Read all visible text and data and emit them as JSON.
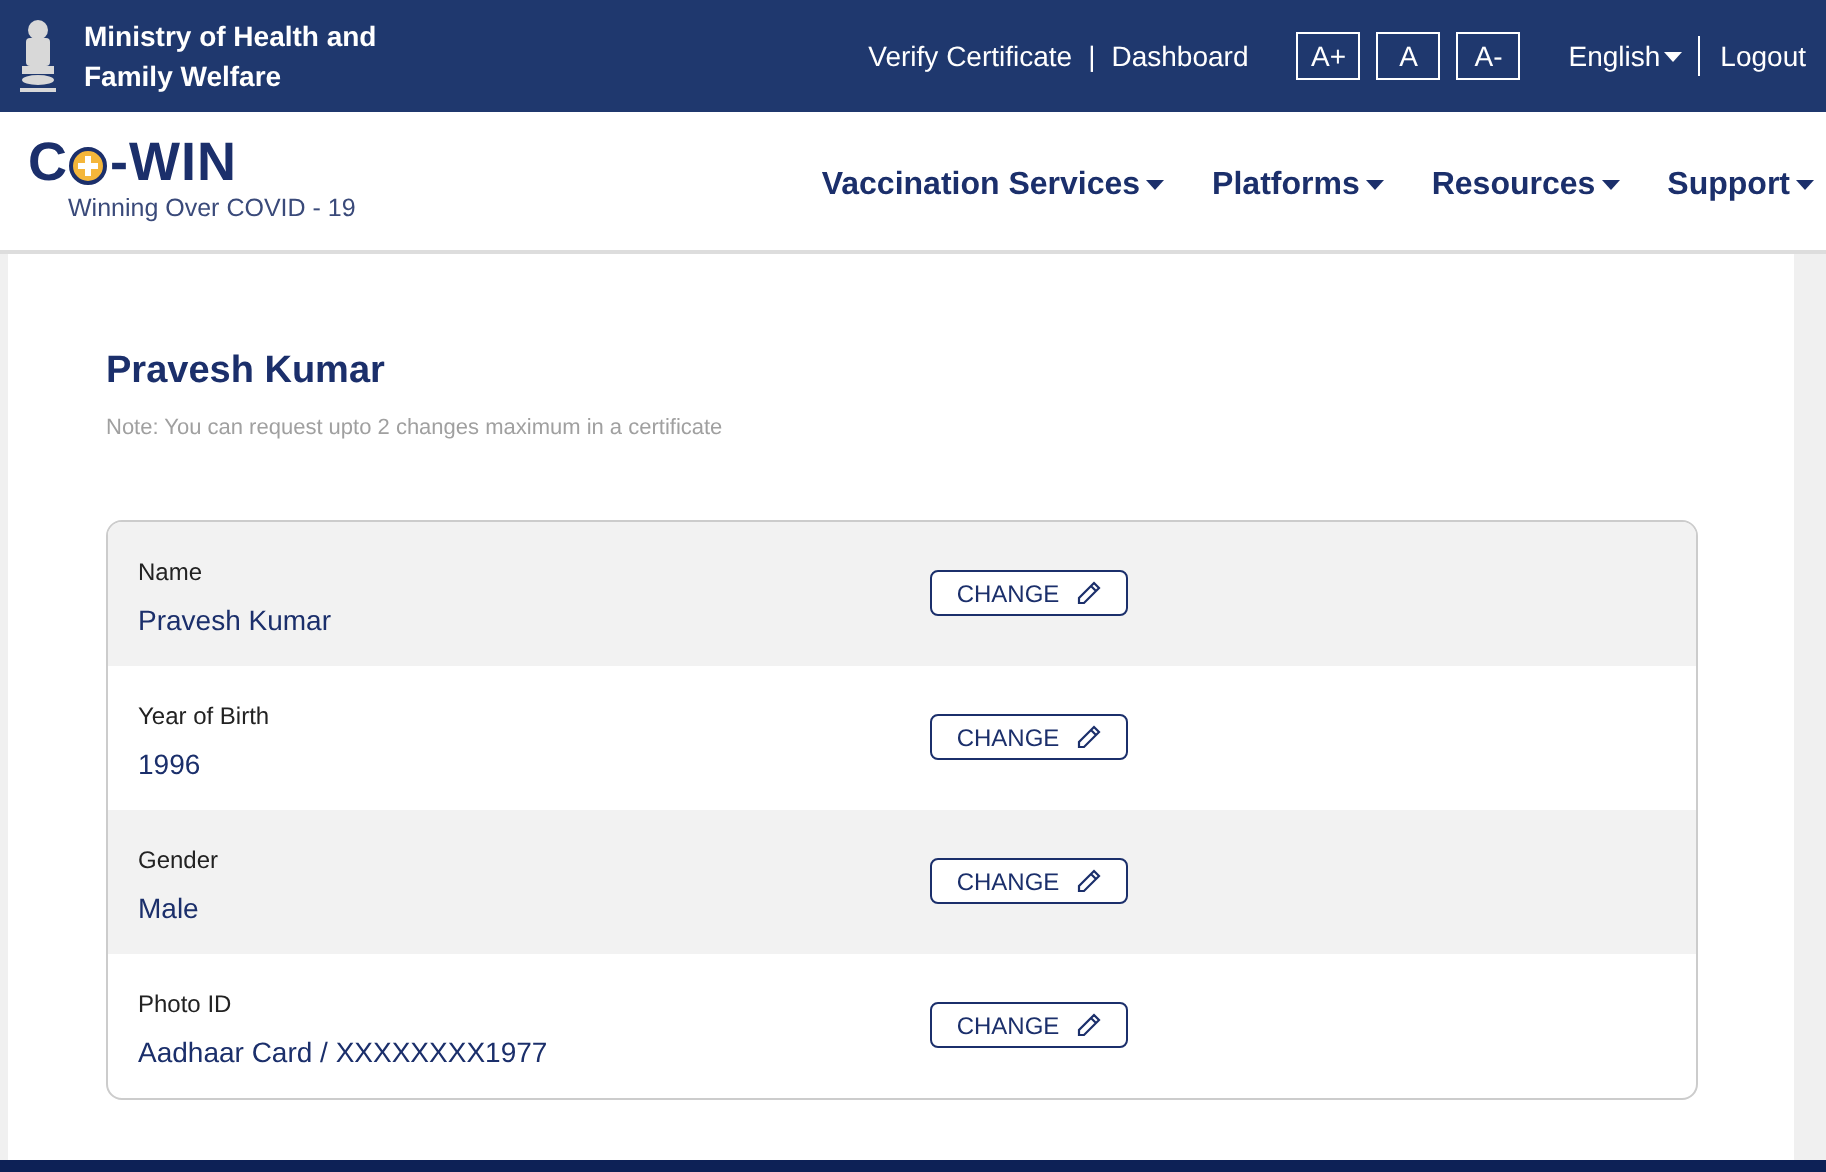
{
  "header": {
    "ministry": [
      "Ministry of Health and",
      "Family Welfare"
    ],
    "links": [
      "Verify Certificate",
      "Dashboard"
    ],
    "separator": "|",
    "font_buttons": [
      "A+",
      "A",
      "A-"
    ],
    "language": "English",
    "logout": "Logout"
  },
  "navbar": {
    "logo": {
      "left": "C",
      "right": "-WIN",
      "tagline": "Winning Over COVID - 19"
    },
    "menus": [
      "Vaccination Services",
      "Platforms",
      "Resources",
      "Support"
    ]
  },
  "profile": {
    "title": "Pravesh Kumar",
    "note": "Note: You can request upto 2 changes maximum in a certificate",
    "fields": [
      {
        "label": "Name",
        "value": "Pravesh Kumar",
        "button": "CHANGE"
      },
      {
        "label": "Year of Birth",
        "value": "1996",
        "button": "CHANGE"
      },
      {
        "label": "Gender",
        "value": "Male",
        "button": "CHANGE"
      },
      {
        "label": "Photo ID",
        "value": "Aadhaar Card / XXXXXXXX1977",
        "button": "CHANGE"
      }
    ]
  }
}
